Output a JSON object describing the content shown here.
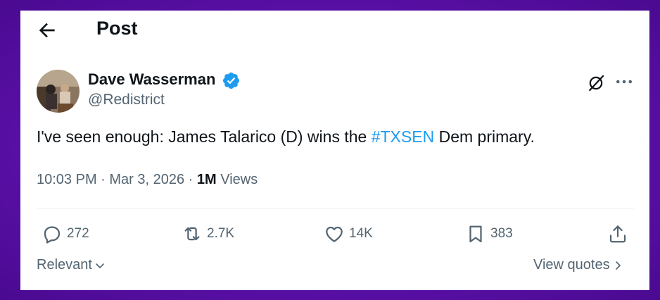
{
  "header": {
    "title": "Post"
  },
  "author": {
    "name": "Dave Wasserman",
    "handle": "@Redistrict"
  },
  "tweet": {
    "text_before": "I've seen enough: James Talarico (D) wins the ",
    "hashtag": "#TXSEN",
    "text_after": " Dem primary."
  },
  "meta": {
    "time": "10:03 PM",
    "sep1": " · ",
    "date": "Mar 3, 2026",
    "sep2": " · ",
    "views_count": "1M",
    "views_label": " Views"
  },
  "actions": {
    "replies": "272",
    "reposts": "2.7K",
    "likes": "14K",
    "bookmarks": "383"
  },
  "footer": {
    "sort_label": "Relevant",
    "quotes_label": "View quotes"
  },
  "colors": {
    "accent": "#1d9bf0",
    "text": "#0f1419",
    "secondary": "#536471",
    "background": "#7b22d0"
  }
}
